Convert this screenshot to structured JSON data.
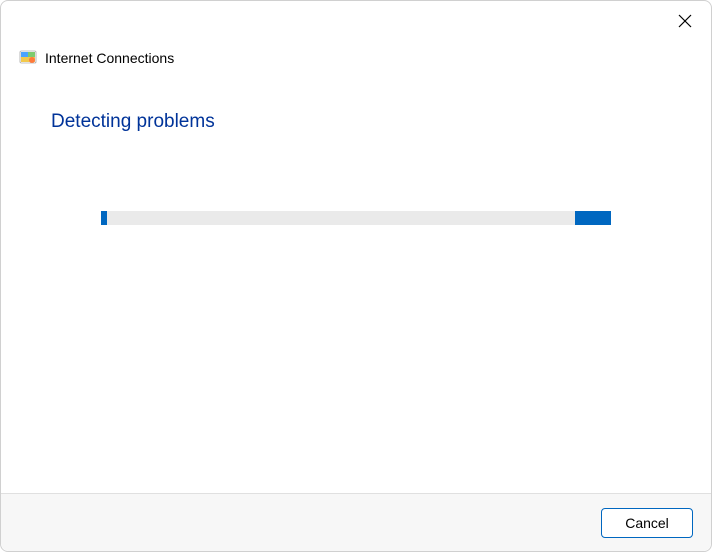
{
  "header": {
    "title": "Internet Connections",
    "icon_name": "network-troubleshoot-icon"
  },
  "content": {
    "heading": "Detecting problems"
  },
  "progress": {
    "accent_color": "#0067c0",
    "track_color": "#eaeaea"
  },
  "footer": {
    "cancel_label": "Cancel"
  }
}
